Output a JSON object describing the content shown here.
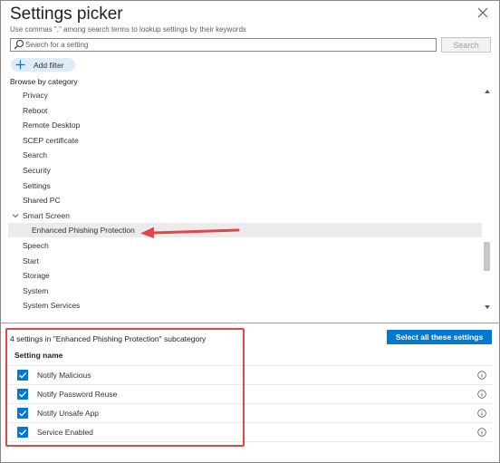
{
  "dialog": {
    "title": "Settings picker",
    "subtitle": "Use commas \",\" among search terms to lookup settings by their keywords",
    "close_icon": "close-icon"
  },
  "search": {
    "placeholder": "Search for a setting",
    "value": "",
    "button_label": "Search"
  },
  "add_filter": {
    "label": "Add filter"
  },
  "browse": {
    "heading": "Browse by category",
    "items": [
      {
        "label": "Privacy",
        "level": 1,
        "expanded": false,
        "selected": false
      },
      {
        "label": "Reboot",
        "level": 1,
        "expanded": false,
        "selected": false
      },
      {
        "label": "Remote Desktop",
        "level": 1,
        "expanded": false,
        "selected": false
      },
      {
        "label": "SCEP certificate",
        "level": 1,
        "expanded": false,
        "selected": false
      },
      {
        "label": "Search",
        "level": 1,
        "expanded": false,
        "selected": false
      },
      {
        "label": "Security",
        "level": 1,
        "expanded": false,
        "selected": false
      },
      {
        "label": "Settings",
        "level": 1,
        "expanded": false,
        "selected": false
      },
      {
        "label": "Shared PC",
        "level": 1,
        "expanded": false,
        "selected": false
      },
      {
        "label": "Smart Screen",
        "level": 1,
        "expanded": true,
        "selected": false
      },
      {
        "label": "Enhanced Phishing Protection",
        "level": 2,
        "expanded": false,
        "selected": true
      },
      {
        "label": "Speech",
        "level": 1,
        "expanded": false,
        "selected": false
      },
      {
        "label": "Start",
        "level": 1,
        "expanded": false,
        "selected": false
      },
      {
        "label": "Storage",
        "level": 1,
        "expanded": false,
        "selected": false
      },
      {
        "label": "System",
        "level": 1,
        "expanded": false,
        "selected": false
      },
      {
        "label": "System Services",
        "level": 1,
        "expanded": false,
        "selected": false
      }
    ]
  },
  "results": {
    "summary": "4 settings in \"Enhanced Phishing Protection\" subcategory",
    "select_all_label": "Select all these settings",
    "column_header": "Setting name",
    "settings": [
      {
        "name": "Notify Malicious",
        "checked": true
      },
      {
        "name": "Notify Password Reuse",
        "checked": true
      },
      {
        "name": "Notify Unsafe App",
        "checked": true
      },
      {
        "name": "Service Enabled",
        "checked": true
      }
    ]
  },
  "colors": {
    "accent": "#0078d4",
    "annotation": "#e3464a",
    "selected_row": "#edebe9"
  }
}
